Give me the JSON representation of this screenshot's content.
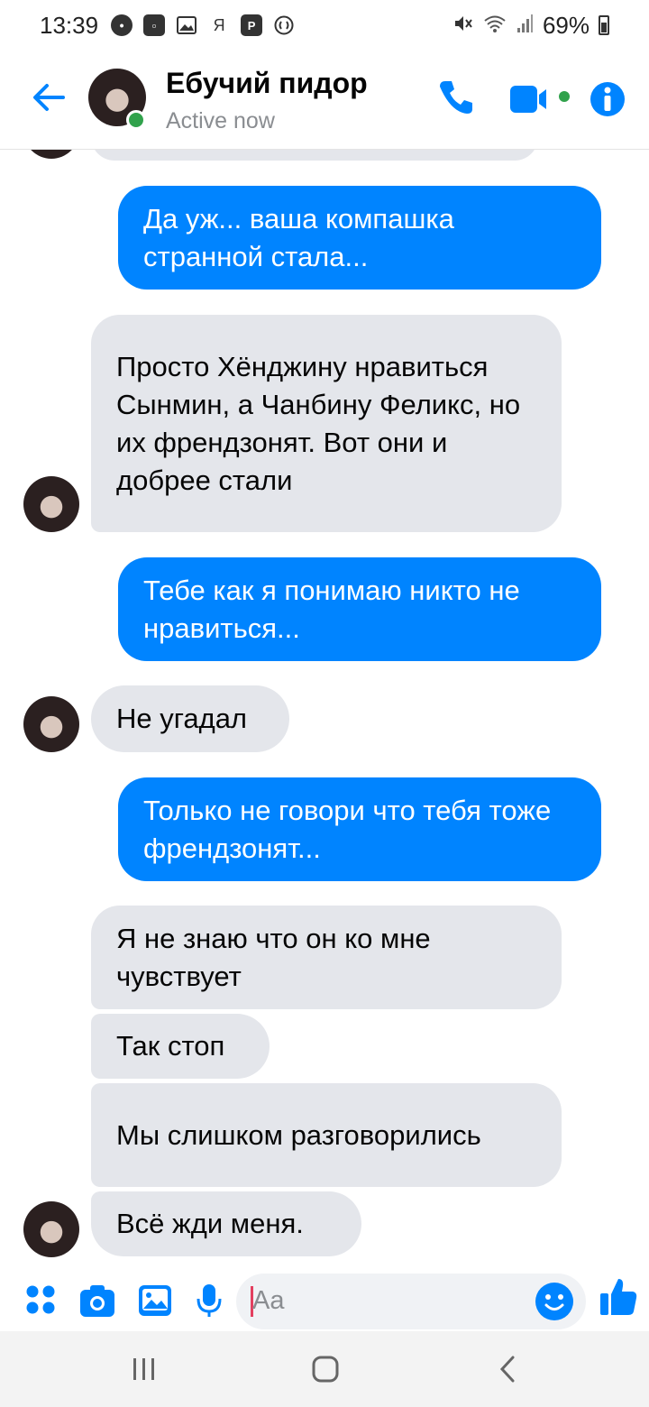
{
  "status_bar": {
    "time": "13:39",
    "battery": "69%",
    "notification_icons": [
      "chat-icon",
      "chat-icon",
      "image-icon",
      "ya-icon",
      "p-icon",
      "shazam-icon"
    ],
    "ya_glyph": "Я",
    "p_glyph": "P"
  },
  "header": {
    "contact_name": "Ебучий пидор",
    "status": "Active now",
    "accent_color": "#0084ff",
    "active_color": "#31a24c"
  },
  "messages": [
    {
      "direction": "out",
      "text": "Да уж... ваша компашка странной стала..."
    },
    {
      "direction": "in",
      "text": "Просто Хёнджину нравиться Сынмин, а Чанбину Феликс, но их френдзонят. Вот они и добрее стали"
    },
    {
      "direction": "out",
      "text": "Тебе как я понимаю никто не нравиться..."
    },
    {
      "direction": "in",
      "text": "Не угадал"
    },
    {
      "direction": "out",
      "text": "Только не говори что тебя тоже френдзонят..."
    },
    {
      "direction": "in",
      "text": "Я не знаю что он ко мне чувствует"
    },
    {
      "direction": "in",
      "text": "Так стоп"
    },
    {
      "direction": "in",
      "text": "Мы слишком разговорились"
    },
    {
      "direction": "in",
      "text": "Всё жди меня."
    }
  ],
  "composer": {
    "placeholder": "Aa"
  },
  "colors": {
    "outgoing_bubble": "#0084ff",
    "incoming_bubble": "#e4e6eb"
  }
}
